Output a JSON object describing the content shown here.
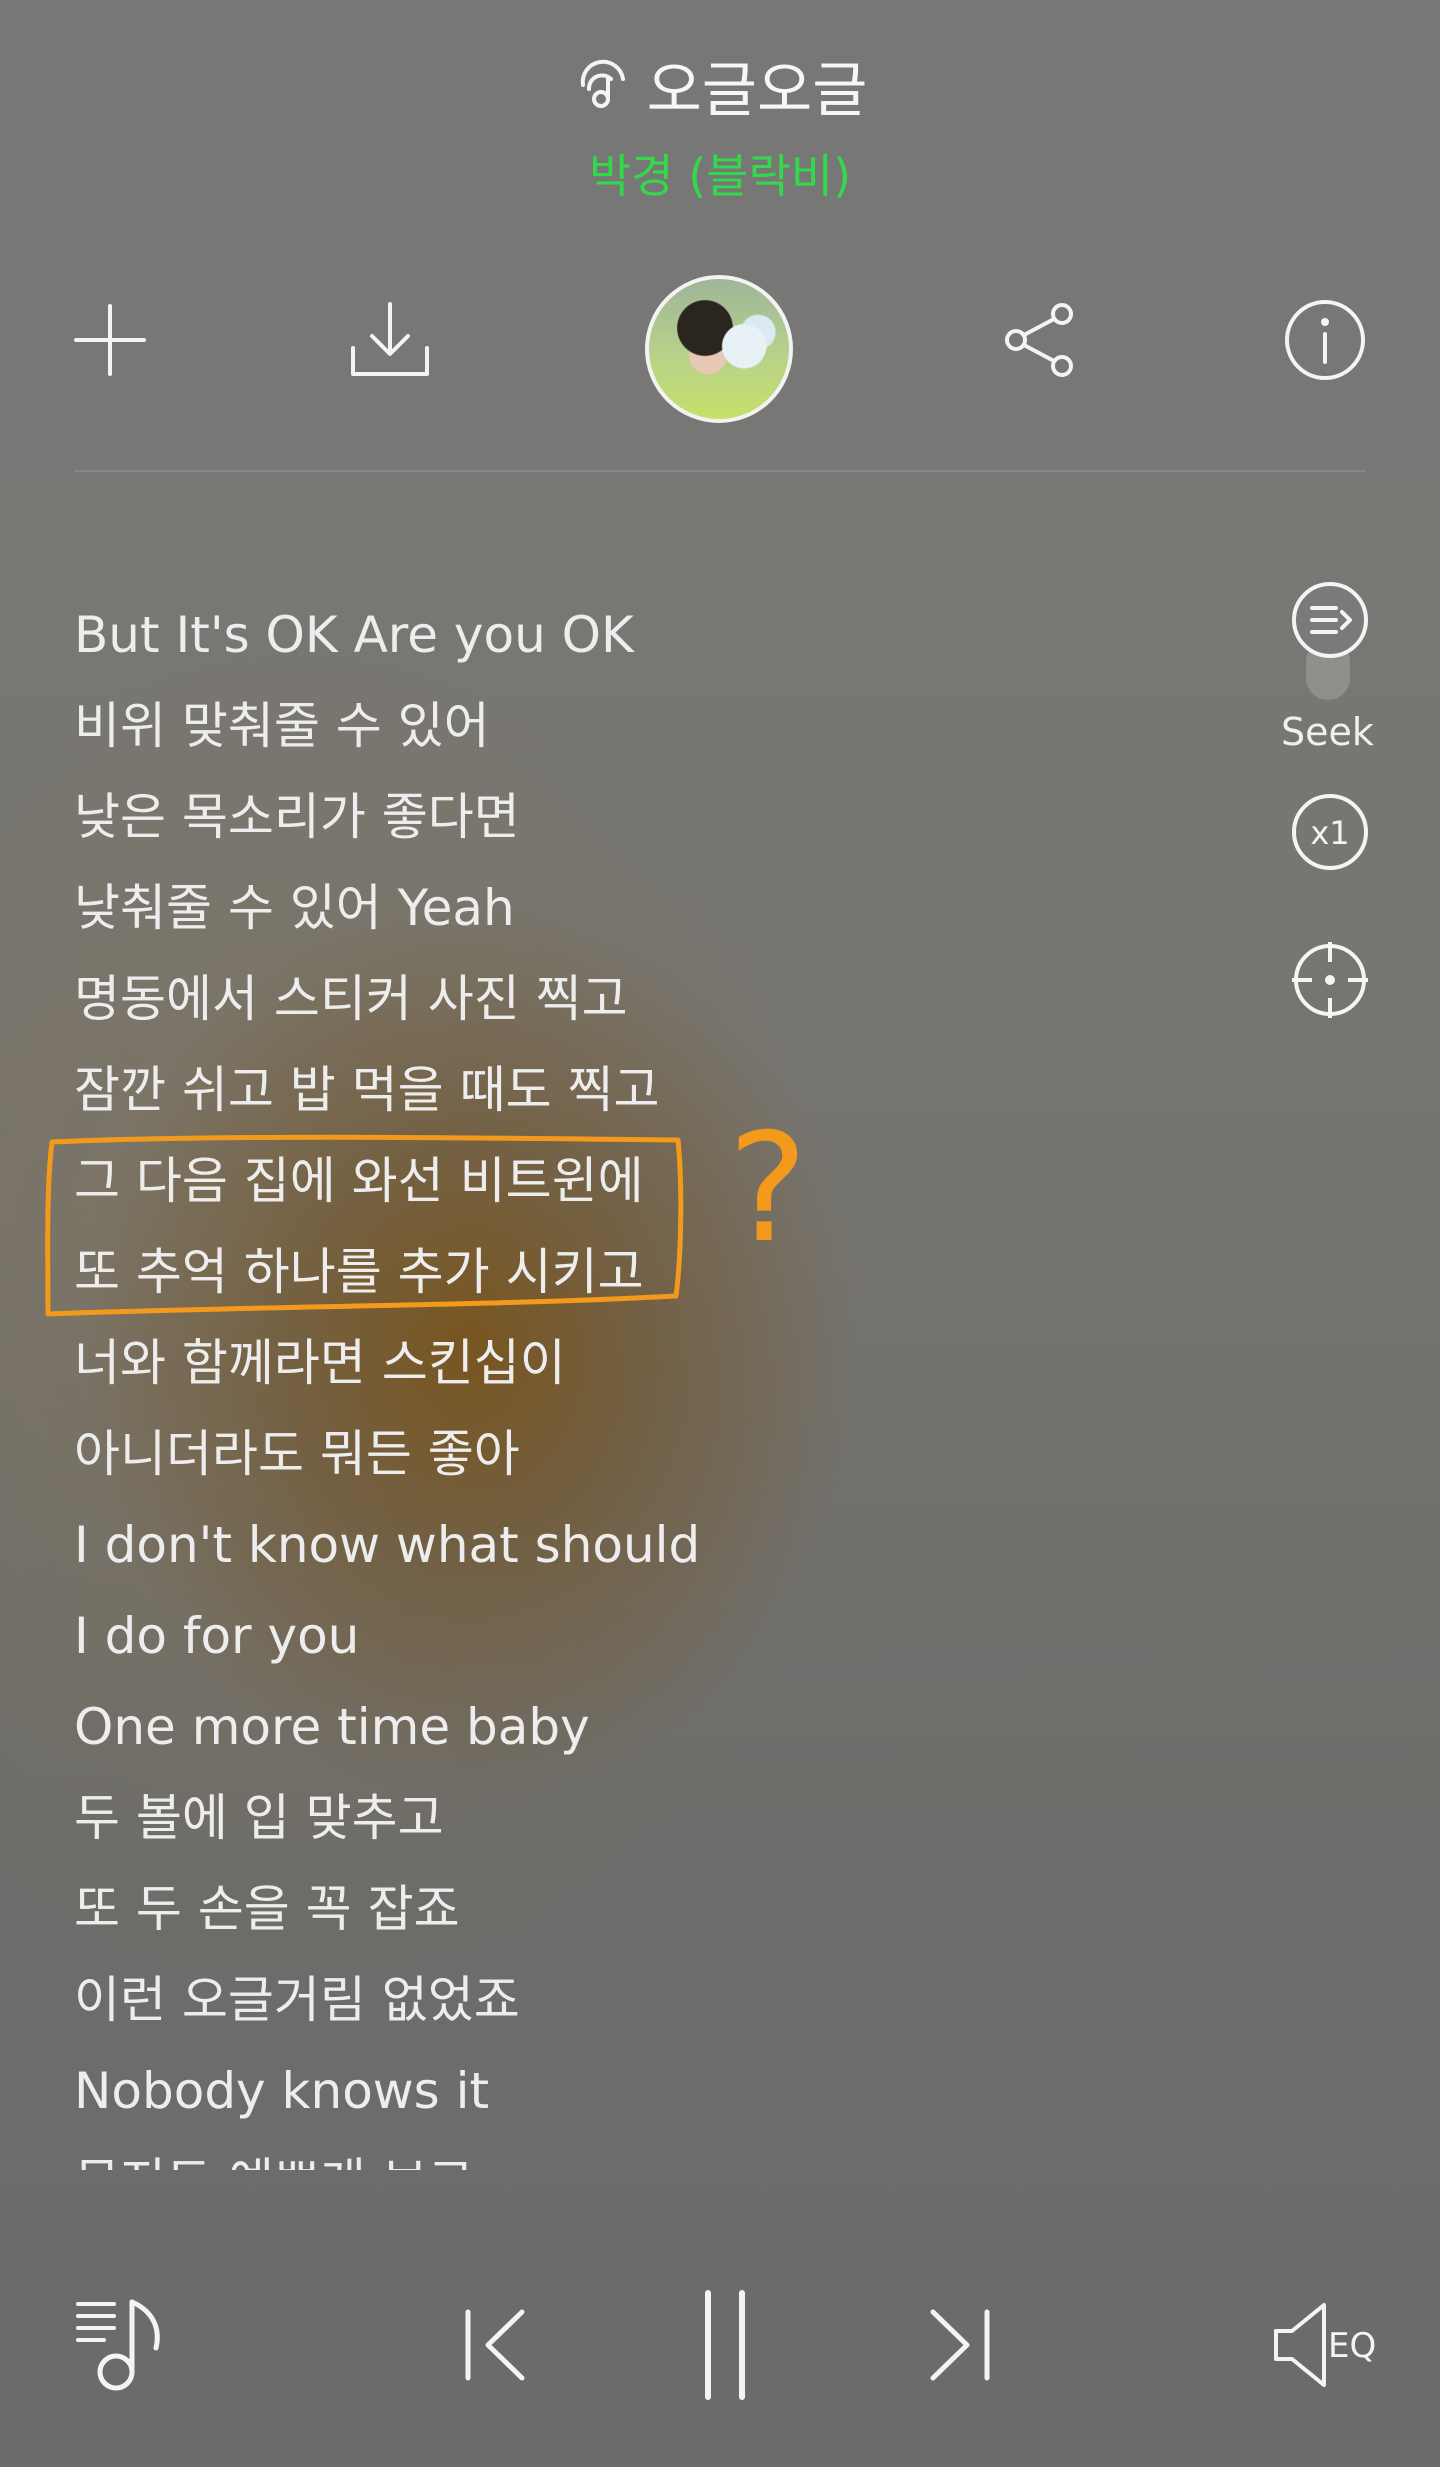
{
  "header": {
    "title": "오글오글",
    "title_icon": "music-note-search-icon",
    "artist": "박경 (블락비)"
  },
  "toolbar": {
    "add_icon": "plus-icon",
    "download_icon": "download-icon",
    "avatar": "album-art-avatar",
    "share_icon": "share-icon",
    "info_icon": "info-icon"
  },
  "side_controls": {
    "scroll_icon": "auto-scroll-icon",
    "seek_label": "Seek",
    "speed_label": "x1",
    "locate_icon": "crosshair-icon"
  },
  "lyrics": [
    "But It's OK Are you OK",
    "비위 맞춰줄 수 있어",
    "낮은 목소리가 좋다면",
    "낮춰줄 수 있어 Yeah",
    "명동에서 스티커 사진 찍고",
    "잠깐 쉬고 밥 먹을 때도 찍고",
    "그 다음 집에 와선 비트윈에",
    "또 추억 하나를 추가 시키고",
    "너와 함께라면 스킨십이",
    "아니더라도 뭐든 좋아",
    "I don't know what should",
    "I do for you",
    "One more time baby",
    "두 볼에 입 맞추고",
    "또 두 손을 꼭 잡죠",
    "이런 오글거림 없었죠",
    "Nobody knows it",
    "무지도 예쁘게 보고"
  ],
  "annotation": {
    "mark": "?",
    "color": "#f39a1c"
  },
  "player": {
    "playlist_icon": "playlist-note-icon",
    "prev_icon": "previous-icon",
    "pause_icon": "pause-icon",
    "next_icon": "next-icon",
    "eq_label": "EQ",
    "eq_icon": "speaker-eq-icon"
  },
  "colors": {
    "artist": "#33d94a",
    "annotation": "#f39a1c",
    "text": "#f2f2f2"
  }
}
